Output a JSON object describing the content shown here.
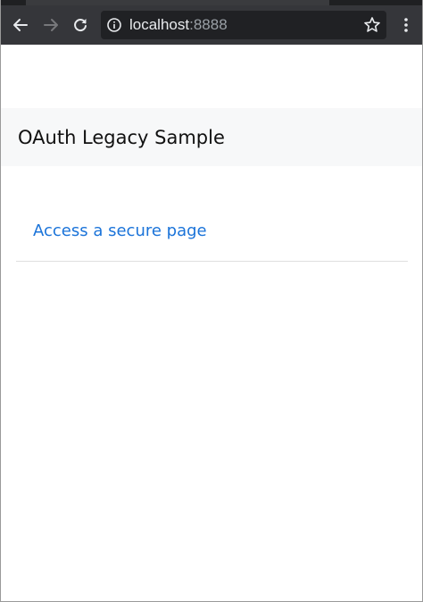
{
  "browser": {
    "url_host": "localhost",
    "url_port": ":8888",
    "icons": {
      "back": "back-arrow-icon",
      "forward": "forward-arrow-icon",
      "reload": "reload-icon",
      "site_info": "info-icon",
      "bookmark": "star-icon",
      "menu": "kebab-menu-icon"
    }
  },
  "page": {
    "brand": "OAuth Legacy Sample",
    "links": [
      {
        "label": "Access a secure page"
      }
    ]
  },
  "colors": {
    "toolbar_bg": "#35363a",
    "omnibox_bg": "#202124",
    "navbar_bg": "#f7f8f9",
    "link": "#1a73d9"
  }
}
